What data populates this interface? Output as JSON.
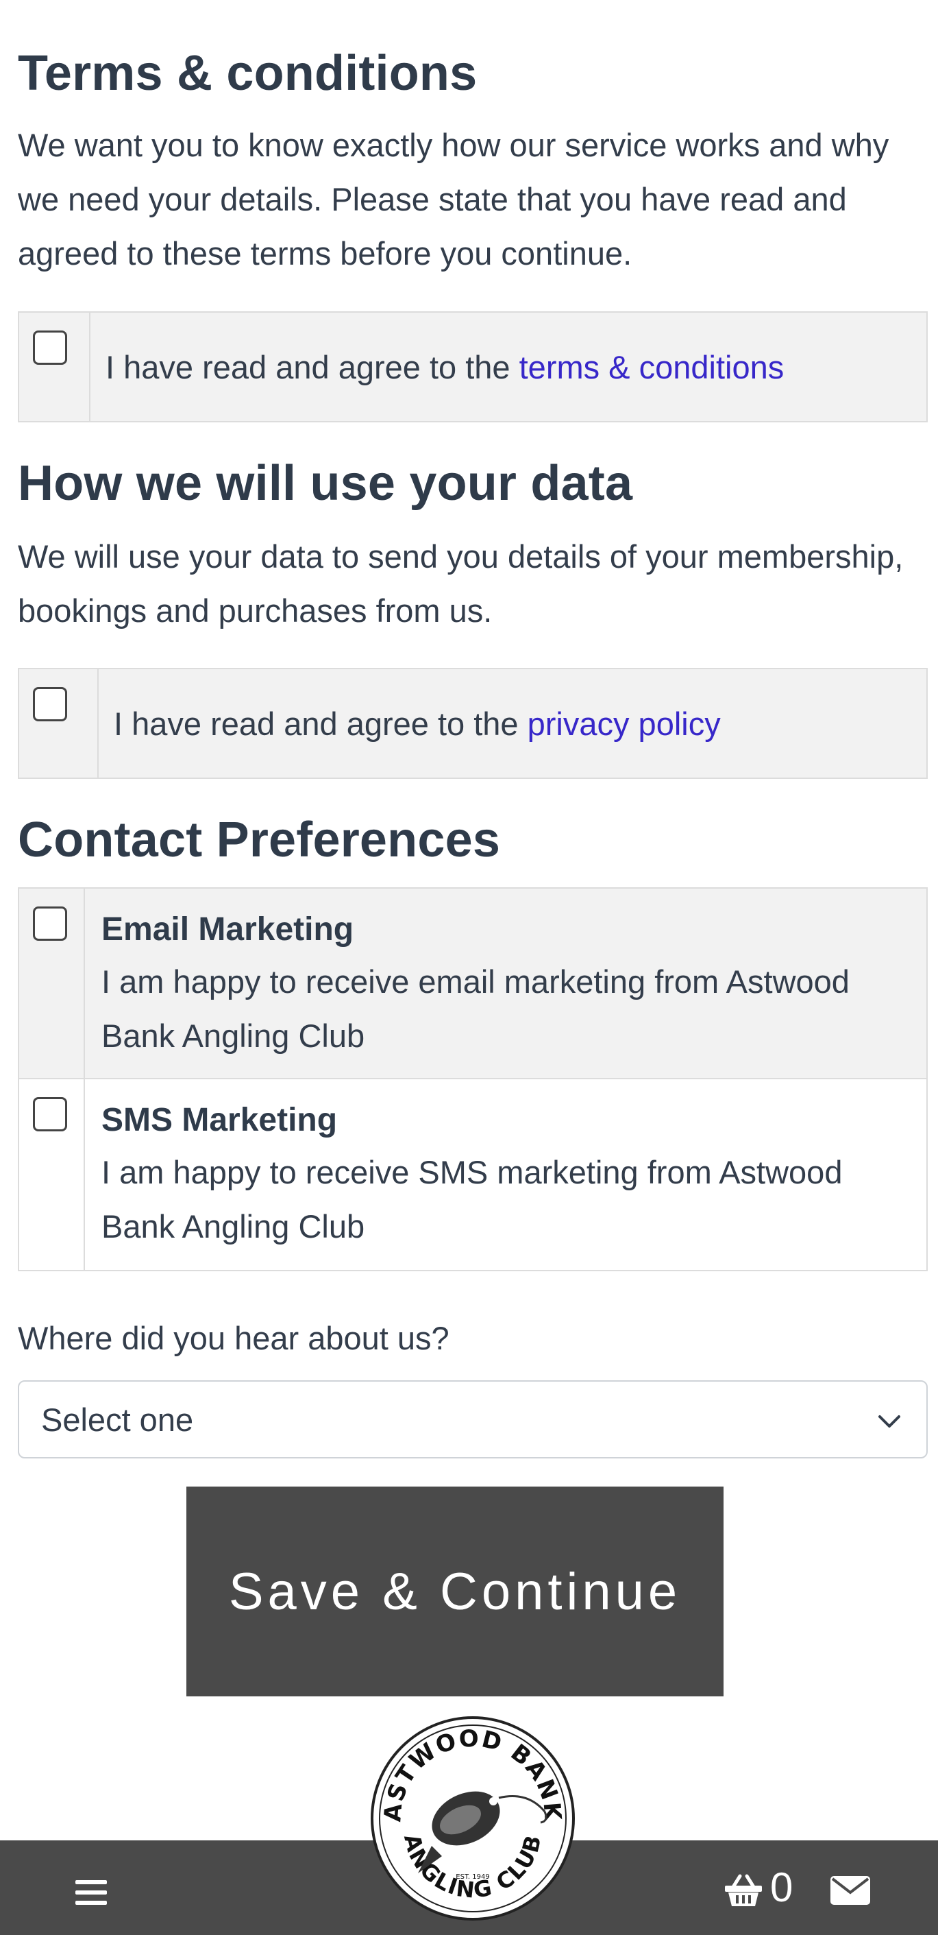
{
  "terms": {
    "heading": "Terms & conditions",
    "paragraph": "We want you to know exactly how our service works and why we need your details. Please state that you have read and agreed to these terms before you continue.",
    "agree_prefix": "I have read and agree to the ",
    "agree_link": "terms & conditions",
    "checked": false
  },
  "data_use": {
    "heading": "How we will use your data",
    "paragraph": "We will use your data to send you details of your membership, bookings and purchases from us.",
    "agree_prefix": "I have read and agree to the ",
    "agree_link": "privacy policy",
    "checked": false
  },
  "contact": {
    "heading": "Contact Preferences",
    "options": [
      {
        "title": "Email Marketing",
        "text": "I am happy to receive email marketing from Astwood Bank Angling Club",
        "checked": false
      },
      {
        "title": "SMS Marketing",
        "text": "I am happy to receive SMS marketing from Astwood Bank Angling Club",
        "checked": false
      }
    ]
  },
  "hear_about": {
    "label": "Where did you hear about us?",
    "selected": "Select one"
  },
  "save_button": "Save & Continue",
  "logo": {
    "top_text": "ASTWOOD BANK",
    "bottom_text": "ANGLING CLUB",
    "est": "EST. 1949"
  },
  "bottom_bar": {
    "cart_count": "0",
    "menu_icon": "hamburger-icon",
    "basket_icon": "basket-icon",
    "mail_icon": "envelope-icon"
  },
  "colors": {
    "link": "#3727c9",
    "button": "#4a4a4a",
    "panel": "#f2f2f2",
    "heading": "#2f3b4a"
  }
}
